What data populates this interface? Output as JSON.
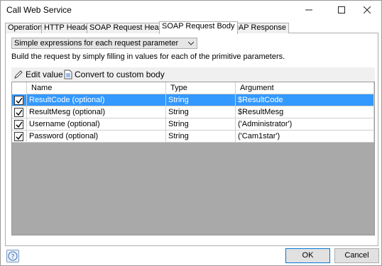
{
  "window": {
    "title": "Call Web Service",
    "minimize_icon": "minimize-icon",
    "maximize_icon": "maximize-icon",
    "close_icon": "close-icon"
  },
  "tabs": [
    {
      "label": "Operation",
      "active": false
    },
    {
      "label": "HTTP Headers",
      "active": false
    },
    {
      "label": "SOAP Request Header",
      "active": false
    },
    {
      "label": "SOAP Request Body",
      "active": true
    },
    {
      "label": "SOAP Response",
      "active": false
    }
  ],
  "body": {
    "mode_select": "Simple expressions for each request parameter",
    "description": "Build the request by simply filling in values for each of the primitive parameters.",
    "toolbar": {
      "edit_label": "Edit value",
      "convert_label": "Convert to custom body"
    },
    "columns": [
      "Name",
      "Type",
      "Argument"
    ],
    "rows": [
      {
        "checked": true,
        "name": "ResultCode (optional)",
        "type": "String",
        "argument": "$ResultCode",
        "selected": true
      },
      {
        "checked": true,
        "name": "ResultMesg (optional)",
        "type": "String",
        "argument": "$ResultMesg",
        "selected": false
      },
      {
        "checked": true,
        "name": "Username (optional)",
        "type": "String",
        "argument": "('Administrator')",
        "selected": false
      },
      {
        "checked": true,
        "name": "Password (optional)",
        "type": "String",
        "argument": "('Cam1star')",
        "selected": false
      }
    ]
  },
  "footer": {
    "help_icon": "help-icon",
    "ok_label": "OK",
    "cancel_label": "Cancel"
  },
  "colors": {
    "selection": "#3399ff",
    "grid_background": "#a9a9a9",
    "toolbar_background": "#f0f0f0"
  }
}
